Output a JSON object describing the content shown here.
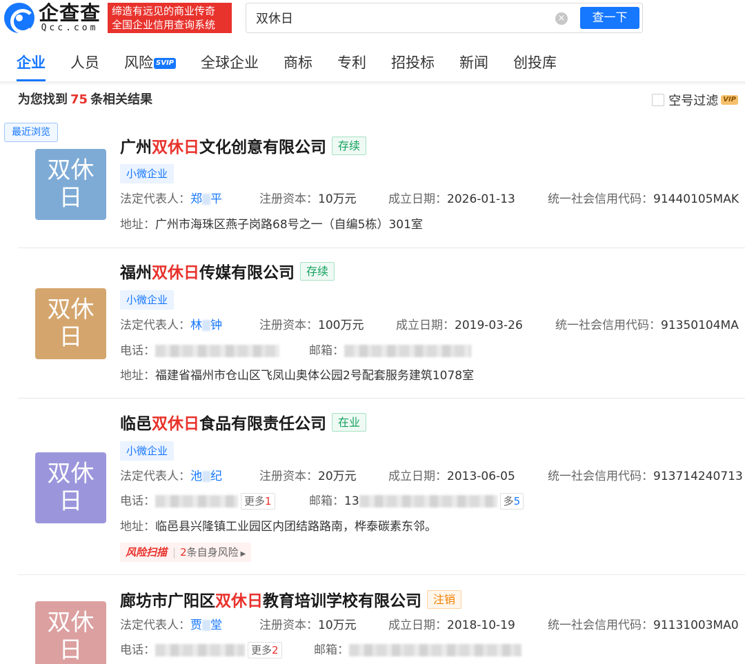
{
  "header": {
    "logo_cn": "企查查",
    "logo_en": "Qcc.com",
    "slogan_line1": "缔造有远见的商业传奇",
    "slogan_line2": "全国企业信用查询系统",
    "search_value": "双休日",
    "clear_icon": "close-circle-icon",
    "search_button": "查一下"
  },
  "tabs": [
    {
      "label": "企业",
      "active": true
    },
    {
      "label": "人员"
    },
    {
      "label": "风险",
      "badge": "SVIP"
    },
    {
      "label": "全球企业"
    },
    {
      "label": "商标"
    },
    {
      "label": "专利"
    },
    {
      "label": "招投标"
    },
    {
      "label": "新闻"
    },
    {
      "label": "创投库"
    }
  ],
  "summary": {
    "prefix": "为您找到",
    "count": "75",
    "suffix": "条相关结果"
  },
  "filter": {
    "label": "空号过滤",
    "badge": "VIP"
  },
  "recent_label": "最近浏览",
  "colors": {
    "accent": "#1677ff",
    "highlight": "#e8322c",
    "active_status": "#13a05e",
    "cancelled_status": "#f08000"
  },
  "results": [
    {
      "avatar_l1": "双休",
      "avatar_l2": "日",
      "avatar_color": "#7eabd6",
      "name_pre": "广州",
      "name_hl": "双休日",
      "name_post": "文化创意有限公司",
      "status": "存续",
      "tag": "小微企业",
      "legal_label": "法定代表人：",
      "legal_a": "郑",
      "legal_b": "平",
      "capital_label": "注册资本：",
      "capital": "10万元",
      "date_label": "成立日期：",
      "date": "2026-01-13",
      "code_label": "统一社会信用代码：",
      "code": "91440105MAK",
      "address_label": "地址：",
      "address": "广州市海珠区燕子岗路68号之一（自编5栋）301室"
    },
    {
      "avatar_l1": "双休",
      "avatar_l2": "日",
      "avatar_color": "#d4a66e",
      "name_pre": "福州",
      "name_hl": "双休日",
      "name_post": "传媒有限公司",
      "status": "存续",
      "tag": "小微企业",
      "legal_label": "法定代表人：",
      "legal_a": "林",
      "legal_b": "钟",
      "capital_label": "注册资本：",
      "capital": "100万元",
      "date_label": "成立日期：",
      "date": "2019-03-26",
      "code_label": "统一社会信用代码：",
      "code": "91350104MA",
      "phone_label": "电话：",
      "email_label": "邮箱：",
      "address_label": "地址：",
      "address": "福建省福州市仓山区飞凤山奥体公园2号配套服务建筑1078室"
    },
    {
      "avatar_l1": "双休",
      "avatar_l2": "日",
      "avatar_color": "#9b96dc",
      "name_pre": "临邑",
      "name_hl": "双休日",
      "name_post": "食品有限责任公司",
      "status": "在业",
      "tag": "小微企业",
      "legal_label": "法定代表人：",
      "legal_a": "池",
      "legal_b": "纪",
      "capital_label": "注册资本：",
      "capital": "20万元",
      "date_label": "成立日期：",
      "date": "2013-06-05",
      "code_label": "统一社会信用代码：",
      "code": "913714240713",
      "phone_label": "电话：",
      "phone_more": "更多",
      "phone_more_count": "1",
      "email_label": "邮箱：",
      "email_prefix": "13",
      "email_more": "多",
      "email_more_count": "5",
      "address_label": "地址：",
      "address": "临邑县兴隆镇工业园区内团结路路南，桦泰碳素东邻。",
      "risk_label": "风险扫描",
      "risk_count": "2",
      "risk_text": "条自身风险"
    },
    {
      "avatar_l1": "双休",
      "avatar_l2": "日",
      "avatar_color": "#dca0a0",
      "name_pre": "廊坊市广阳区",
      "name_hl": "双休日",
      "name_post": "教育培训学校有限公司",
      "status": "注销",
      "legal_label": "法定代表人：",
      "legal_a": "贾",
      "legal_b": "堂",
      "capital_label": "注册资本：",
      "capital": "10万元",
      "date_label": "成立日期：",
      "date": "2018-10-19",
      "code_label": "统一社会信用代码：",
      "code": "91131003MA0",
      "phone_label": "电话：",
      "phone_more": "更多",
      "phone_more_count": "2",
      "email_label": "邮箱："
    }
  ]
}
